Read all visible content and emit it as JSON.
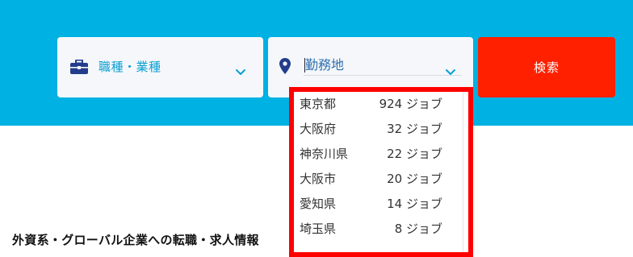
{
  "search_bar": {
    "job_field": {
      "label": "職種・業種",
      "icon": "briefcase-icon"
    },
    "location_field": {
      "placeholder": "勤務地",
      "value": "",
      "icon": "map-pin-icon"
    },
    "search_button_label": "検索"
  },
  "location_dropdown": {
    "options": [
      {
        "name": "東京都",
        "count": "924 ジョブ"
      },
      {
        "name": "大阪府",
        "count": "32 ジョブ"
      },
      {
        "name": "神奈川県",
        "count": "22 ジョブ"
      },
      {
        "name": "大阪市",
        "count": "20 ジョブ"
      },
      {
        "name": "愛知県",
        "count": "14 ジョブ"
      },
      {
        "name": "埼玉県",
        "count": "8 ジョブ"
      }
    ]
  },
  "content": {
    "headline": "外資系・グローバル企業への転職・求人情報"
  },
  "colors": {
    "hero_bg": "#00b1e3",
    "search_button": "#ff2000",
    "highlight_border": "#ff0000",
    "field_text": "#0a9fd3",
    "icon_navy": "#233d8c"
  }
}
